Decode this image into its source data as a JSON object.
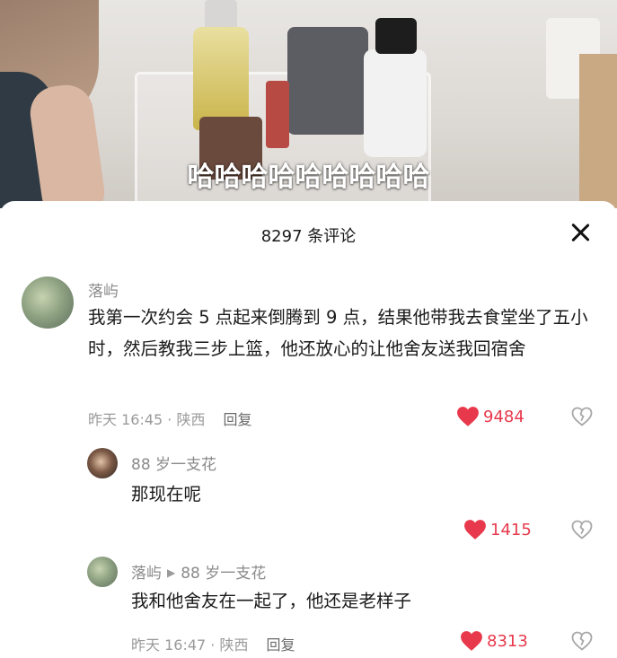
{
  "video": {
    "overlay_text": "哈哈哈哈哈哈哈哈哈"
  },
  "sheet": {
    "title": "8297 条评论"
  },
  "comments": [
    {
      "username": "落屿",
      "content": "我第一次约会 5 点起来倒腾到 9 点，结果他带我去食堂坐了五小时，然后教我三步上篮，他还放心的让他舍友送我回宿舍",
      "time_location": "昨天 16:45 · 陕西",
      "reply_label": "回复",
      "likes": "9484"
    },
    {
      "username": "88 岁一支花",
      "content": "那现在呢",
      "likes": "1415"
    },
    {
      "username": "落屿",
      "reply_to": "88 岁一支花",
      "content": "我和他舍友在一起了，他还是老样子",
      "time_location": "昨天 16:47 · 陕西",
      "reply_label": "回复",
      "likes": "8313"
    }
  ],
  "colors": {
    "like": "#e8394c",
    "meta": "#9a9a9a"
  }
}
